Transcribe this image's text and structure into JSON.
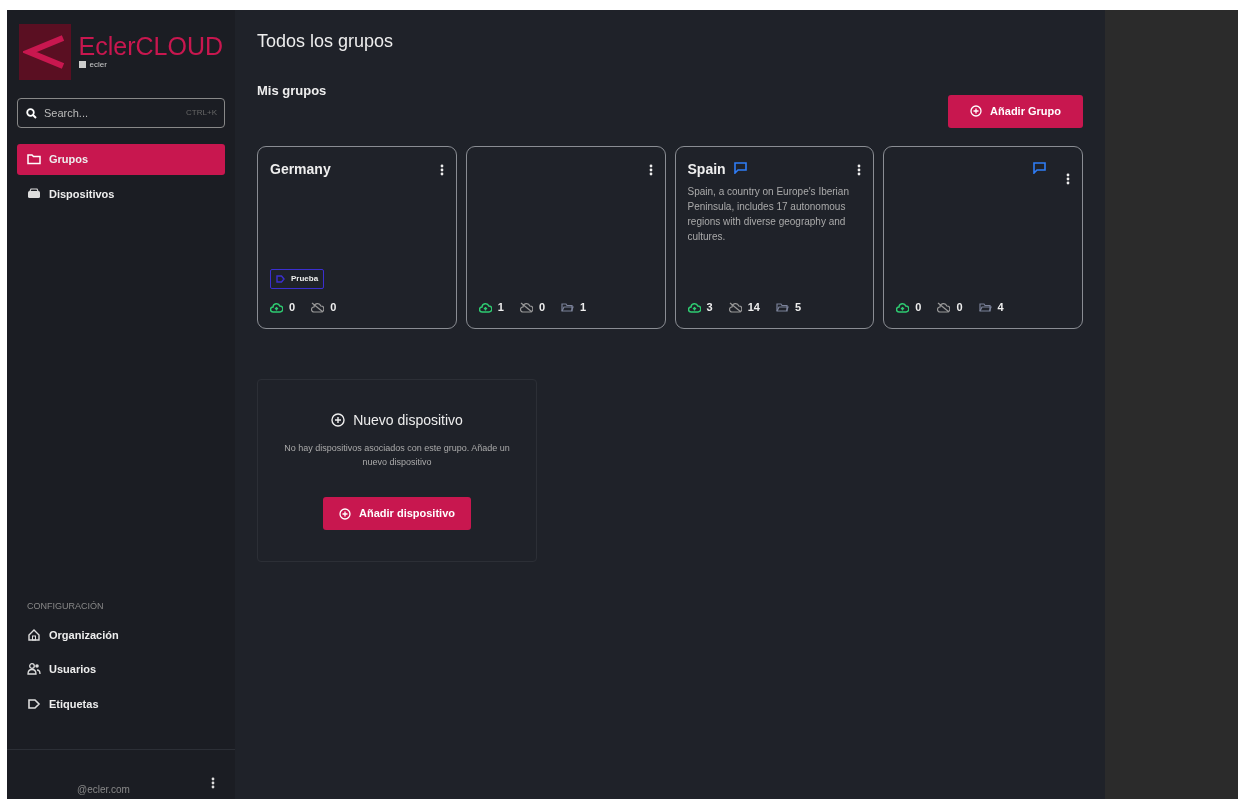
{
  "sidebar": {
    "brand": "EclerCLOUD",
    "brand_sub": "ecler",
    "search": {
      "placeholder": "Search...",
      "shortcut": "CTRL+K"
    },
    "nav": [
      {
        "label": "Grupos",
        "kind": "folder",
        "selected": true
      },
      {
        "label": "Dispositivos",
        "kind": "device",
        "selected": false
      }
    ],
    "config_heading": "CONFIGURACIÓN",
    "config": [
      {
        "label": "Organización",
        "kind": "home",
        "selected": false
      },
      {
        "label": "Usuarios",
        "kind": "users",
        "selected": false
      },
      {
        "label": "Etiquetas",
        "kind": "tag",
        "selected": false
      }
    ],
    "footer_user": "@ecler.com"
  },
  "page_title": "Todos los grupos",
  "section_title": "Mis grupos",
  "add_group_button": "Añadir Grupo",
  "groups": [
    {
      "name": "Germany",
      "has_comment": false,
      "tags": [
        {
          "label": "Prueba",
          "color": "#3b2fd0"
        }
      ],
      "online": "0",
      "offline": "0"
    },
    {
      "has_comment": false,
      "online": "1",
      "offline": "0",
      "folders": "1"
    },
    {
      "name": "Spain",
      "has_comment": true,
      "description": "Spain, a country on Europe's Iberian Peninsula, includes 17 autonomous regions with diverse geography and cultures.",
      "online": "3",
      "offline": "14",
      "folders": "5"
    },
    {
      "has_comment": true,
      "online": "0",
      "offline": "0",
      "folders": "4"
    }
  ],
  "empty_state": {
    "title": "Nuevo dispositivo",
    "text": "No hay dispositivos asociados con este grupo. Añade un nuevo dispositivo",
    "button": "Añadir dispositivo"
  }
}
